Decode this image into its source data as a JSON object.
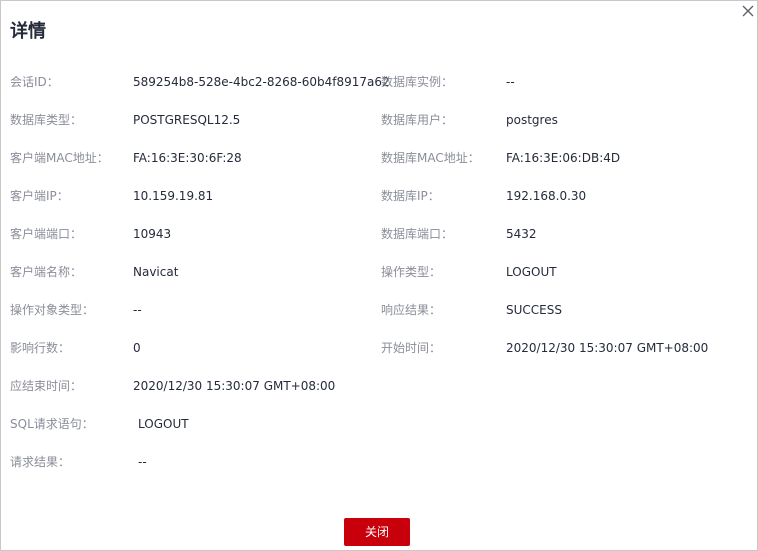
{
  "dialog": {
    "title": "详情",
    "close_icon": "close-icon",
    "close_button_label": "关闭",
    "accent_color": "#c7000b"
  },
  "rows": [
    {
      "label": "会话ID：",
      "value": "589254b8-528e-4bc2-8268-60b4f8917a62",
      "label2": "数据库实例：",
      "value2": "--"
    },
    {
      "label": "数据库类型：",
      "value": "POSTGRESQL12.5",
      "label2": "数据库用户：",
      "value2": "postgres"
    },
    {
      "label": "客户端MAC地址：",
      "value": "FA:16:3E:30:6F:28",
      "label2": "数据库MAC地址：",
      "value2": "FA:16:3E:06:DB:4D"
    },
    {
      "label": "客户端IP：",
      "value": "10.159.19.81",
      "label2": "数据库IP：",
      "value2": "192.168.0.30"
    },
    {
      "label": "客户端端口：",
      "value": "10943",
      "label2": "数据库端口：",
      "value2": "5432"
    },
    {
      "label": "客户端名称：",
      "value": "Navicat",
      "label2": "操作类型：",
      "value2": "LOGOUT"
    },
    {
      "label": "操作对象类型：",
      "value": "--",
      "label2": "响应结果：",
      "value2": "SUCCESS"
    },
    {
      "label": "影响行数：",
      "value": "0",
      "label2": "开始时间：",
      "value2": "2020/12/30 15:30:07 GMT+08:00"
    },
    {
      "label": "应结束时间：",
      "value": "2020/12/30 15:30:07 GMT+08:00"
    },
    {
      "label": "SQL请求语句：",
      "value": "LOGOUT"
    },
    {
      "label": "请求结果：",
      "value": "--"
    }
  ]
}
